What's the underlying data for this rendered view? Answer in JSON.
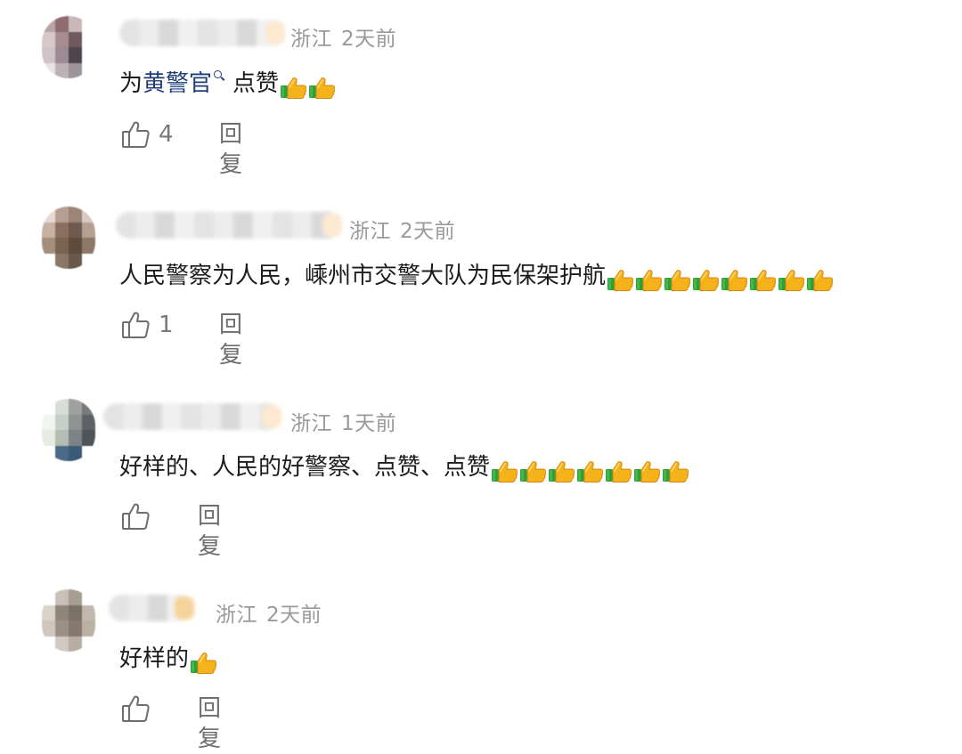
{
  "icons": {
    "like": "thumbs-up-outline-icon",
    "emoji": "thumbs-up-emoji",
    "search": "search-icon"
  },
  "colors": {
    "link": "#1f3e78",
    "meta": "#9a9a9a",
    "text": "#1c1c1c",
    "action": "#6e6e6e"
  },
  "comments": [
    {
      "location": "浙江",
      "time": "2天前",
      "text_prefix": "为",
      "mention": "黄警官",
      "text_suffix": "点赞",
      "emoji_count": 2,
      "likes": "4",
      "reply_label": "回复"
    },
    {
      "location": "浙江",
      "time": "2天前",
      "text": "人民警察为人民，嵊州市交警大队为民保架护航",
      "emoji_count": 8,
      "likes": "1",
      "reply_label": "回复"
    },
    {
      "location": "浙江",
      "time": "1天前",
      "text": "好样的、人民的好警察、点赞、点赞",
      "emoji_count": 7,
      "likes": "",
      "reply_label": "回复"
    },
    {
      "location": "浙江",
      "time": "2天前",
      "text": "好样的",
      "emoji_count": 1,
      "likes": "",
      "reply_label": "回复"
    }
  ]
}
